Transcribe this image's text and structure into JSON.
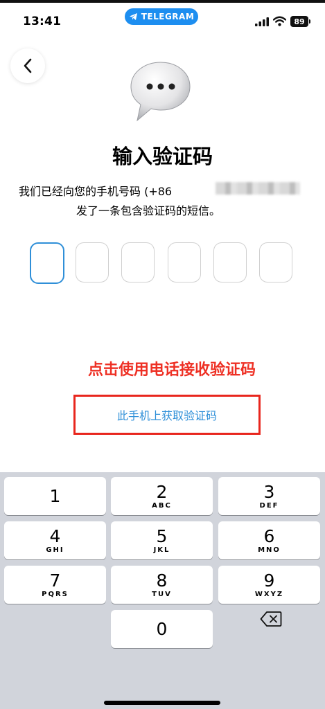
{
  "status_bar": {
    "time": "13:41",
    "app_pill": "TELEGRAM",
    "battery": "89"
  },
  "title": "输入验证码",
  "description": {
    "line1": "我们已经向您的手机号码 (+86",
    "line2": "发了一条包含验证码的短信。"
  },
  "code_length": 6,
  "annotation": "点击使用电话接收验证码",
  "get_code_link": "此手机上获取验证码",
  "keypad": {
    "keys": [
      {
        "num": "1",
        "letters": ""
      },
      {
        "num": "2",
        "letters": "ABC"
      },
      {
        "num": "3",
        "letters": "DEF"
      },
      {
        "num": "4",
        "letters": "GHI"
      },
      {
        "num": "5",
        "letters": "JKL"
      },
      {
        "num": "6",
        "letters": "MNO"
      },
      {
        "num": "7",
        "letters": "PQRS"
      },
      {
        "num": "8",
        "letters": "TUV"
      },
      {
        "num": "9",
        "letters": "WXYZ"
      },
      {
        "num": "0",
        "letters": ""
      }
    ]
  },
  "colors": {
    "accent": "#2d8fd8",
    "telegram_pill": "#1d8ef0",
    "annotation_red": "#ee3024",
    "keypad_bg": "#d1d4db"
  }
}
